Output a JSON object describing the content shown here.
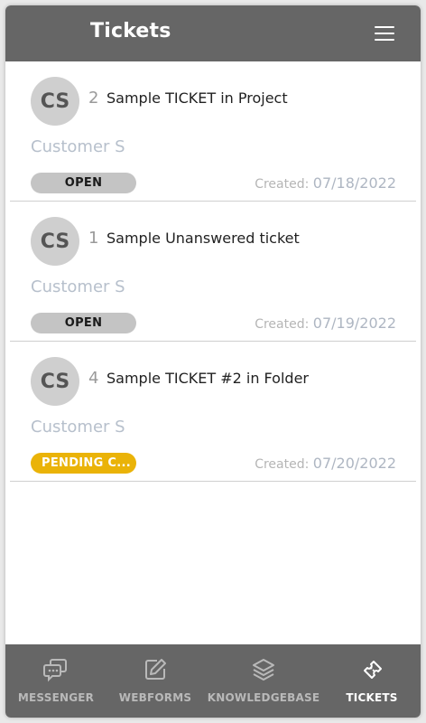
{
  "header": {
    "title": "Tickets",
    "menu_icon": "hamburger-menu-icon"
  },
  "tickets": [
    {
      "initials": "CS",
      "number": "2",
      "subject": "Sample TICKET in Project",
      "customer": "Customer S",
      "status": "OPEN",
      "created_label": "Created:",
      "created_date": "07/18/2022"
    },
    {
      "initials": "CS",
      "number": "1",
      "subject": "Sample Unanswered ticket",
      "customer": "Customer S",
      "status": "OPEN",
      "created_label": "Created:",
      "created_date": "07/19/2022"
    },
    {
      "initials": "CS",
      "number": "4",
      "subject": "Sample TICKET #2 in Folder",
      "customer": "Customer S",
      "status": "PENDING C...",
      "created_label": "Created:",
      "created_date": "07/20/2022"
    }
  ],
  "nav": [
    {
      "label": "MESSENGER",
      "icon": "messenger-icon",
      "active": false
    },
    {
      "label": "WEBFORMS",
      "icon": "webforms-icon",
      "active": false
    },
    {
      "label": "KNOWLEDGEBASE",
      "icon": "knowledgebase-icon",
      "active": false
    },
    {
      "label": "TICKETS",
      "icon": "tickets-icon",
      "active": true
    }
  ],
  "colors": {
    "header_bg": "#666666",
    "open_badge": "#c4c4c4",
    "pending_badge": "#eab308",
    "nav_active": "#ffffff",
    "nav_inactive": "#b9b9b9"
  }
}
